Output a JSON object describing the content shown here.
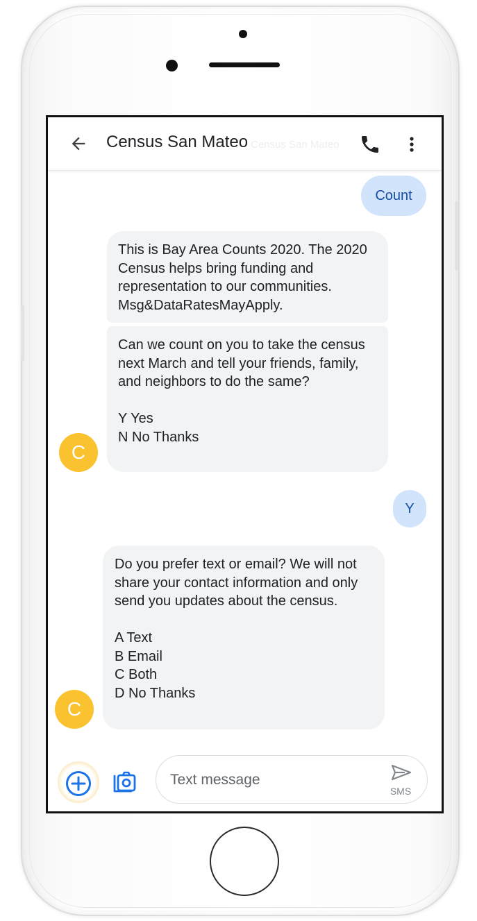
{
  "header": {
    "title": "Census San Mateo",
    "title_ghost": "Census San Mateo"
  },
  "messages": [
    {
      "direction": "outgoing",
      "text": "Count"
    },
    {
      "direction": "incoming",
      "text": "This is Bay Area Counts 2020. The 2020 Census helps bring funding and representation to our communities. Msg&DataRatesMayApply."
    },
    {
      "direction": "incoming",
      "text": "Can we count on you to take the census next March and tell your friends, family, and neighbors to do the same?\n\nY Yes\nN No Thanks"
    },
    {
      "direction": "outgoing",
      "text": "Y"
    },
    {
      "direction": "incoming",
      "text": "Do you prefer text or email? We will not share your contact information and only send you updates about the census.\n\nA Text\nB Email\nC Both\nD No Thanks"
    }
  ],
  "avatar": {
    "initial": "C",
    "color": "#f9c22e"
  },
  "composer": {
    "placeholder": "Text message",
    "send_label": "SMS"
  },
  "colors": {
    "incoming_bubble": "#f1f3f4",
    "outgoing_bubble": "#d2e3fc",
    "outgoing_text": "#174ea6",
    "accent": "#1a73e8"
  },
  "icons": {
    "back": "arrow-back-icon",
    "call": "phone-icon",
    "more": "more-vert-icon",
    "add": "add-circle-icon",
    "camera": "camera-gallery-icon",
    "send": "send-icon"
  }
}
